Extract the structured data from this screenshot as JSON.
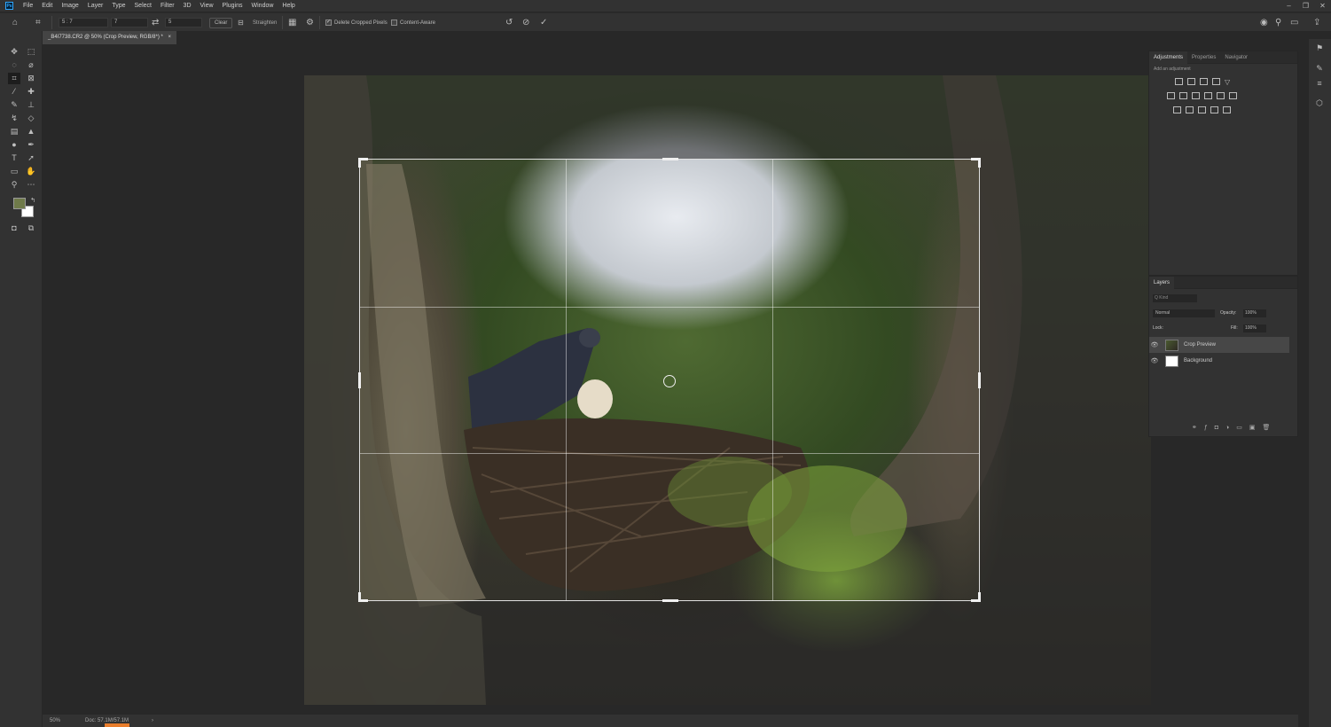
{
  "app": {
    "logo": "Ps",
    "menus": [
      "File",
      "Edit",
      "Image",
      "Layer",
      "Type",
      "Select",
      "Filter",
      "3D",
      "View",
      "Plugins",
      "Window",
      "Help"
    ],
    "window_controls": [
      "–",
      "❐",
      "✕"
    ]
  },
  "options_bar": {
    "ratio_preset": "5 : 7",
    "width_value": "7",
    "height_value": "5",
    "clear_label": "Clear",
    "straighten_label": "Straighten",
    "delete_cropped_label": "Delete Cropped Pixels",
    "delete_cropped_checked": true,
    "content_aware_label": "Content-Aware",
    "content_aware_checked": false,
    "swap_icon": "⇄",
    "reset_icon": "↺",
    "cancel_icon": "⊘",
    "commit_icon": "✓"
  },
  "document": {
    "tab_title": "_B4I7738.CR2 @ 50% (Crop Preview, RGB/8*) *",
    "close": "×"
  },
  "status": {
    "zoom": "50%",
    "doc_info": "Doc: 57.1M/57.1M",
    "arrow": "›"
  },
  "adjustments_panel": {
    "tabs": [
      "Adjustments",
      "Properties",
      "Navigator"
    ],
    "hint": "Add an adjustment"
  },
  "layers_panel": {
    "tab": "Layers",
    "search_placeholder": "Q Kind",
    "blend_mode": "Normal",
    "opacity_label": "Opacity:",
    "opacity_value": "100%",
    "lock_label": "Lock:",
    "fill_label": "Fill:",
    "fill_value": "100%",
    "layers": [
      {
        "name": "Crop Preview",
        "visible": true,
        "selected": true
      },
      {
        "name": "Background",
        "visible": true,
        "selected": false
      }
    ]
  },
  "colors": {
    "foreground": "#6f7a4a",
    "background": "#ffffff",
    "accent_orange": "#e87d2c"
  }
}
